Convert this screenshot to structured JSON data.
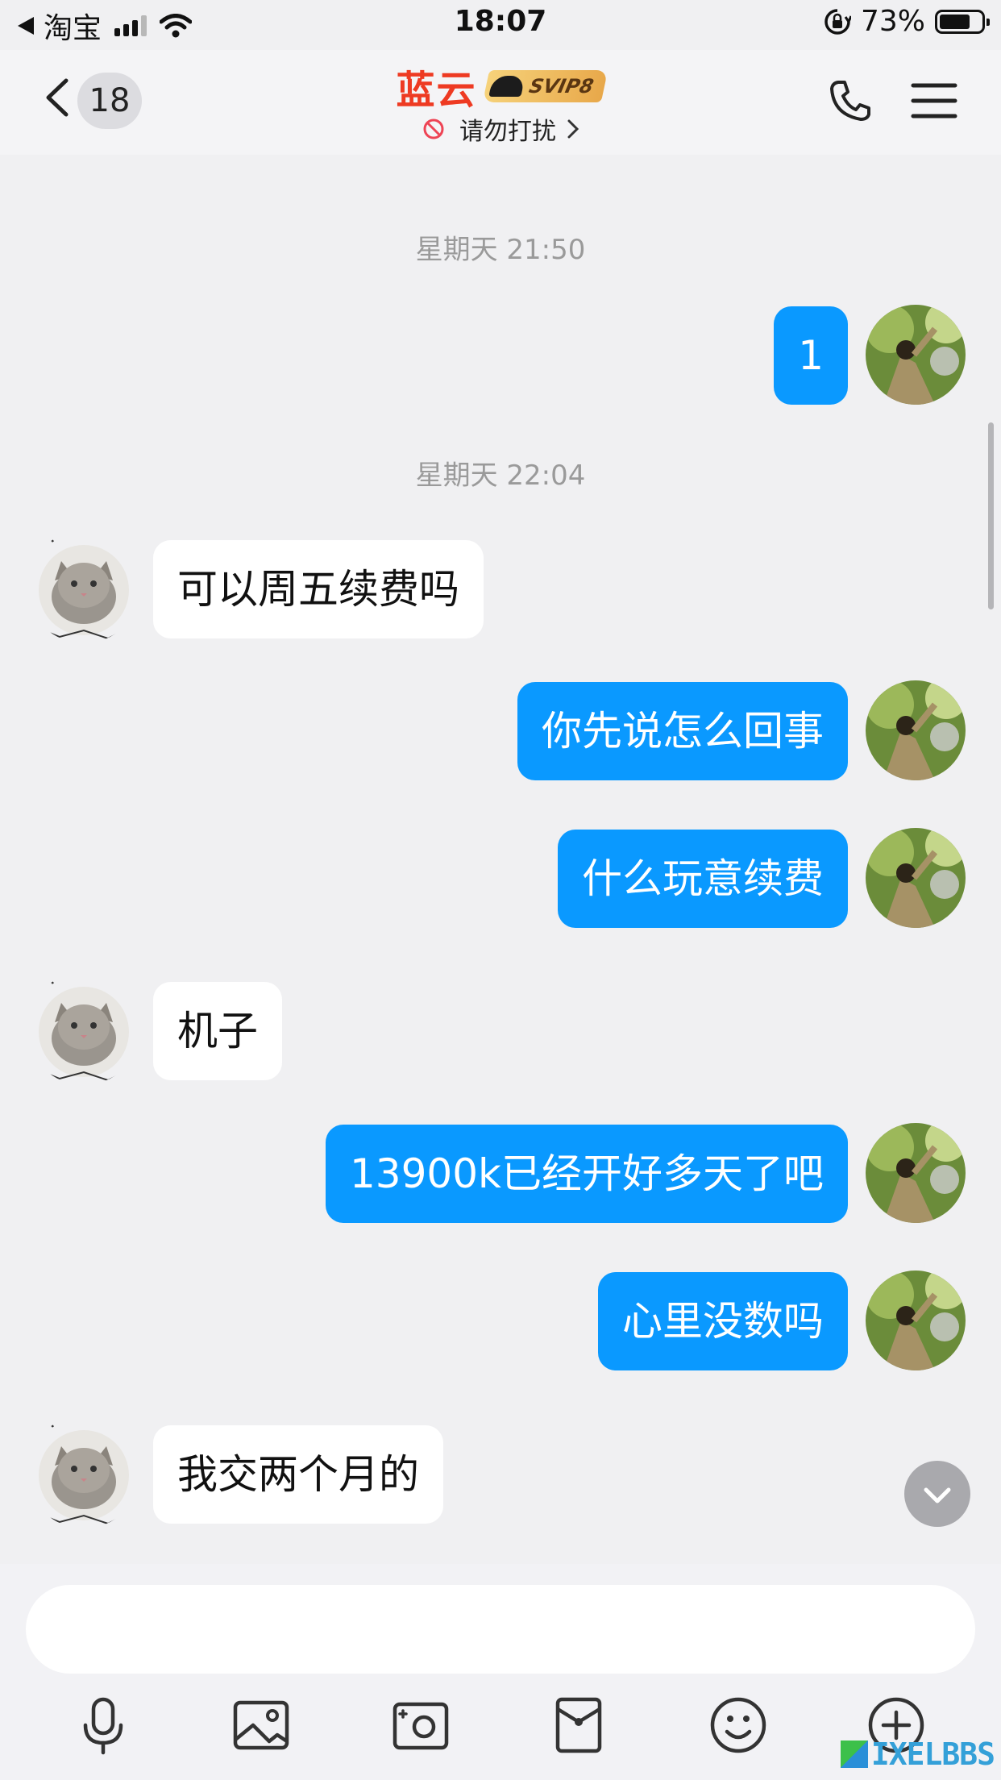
{
  "status_bar": {
    "back_app": "淘宝",
    "time": "18:07",
    "battery": "73%",
    "battery_level": 0.73
  },
  "header": {
    "unread_count": "18",
    "contact_name": "蓝云",
    "vip_badge": "SVIP8",
    "dnd_label": "请勿打扰",
    "title_color": "#ee3a22"
  },
  "chat": {
    "timestamps": [
      "星期天 21:50",
      "星期天 22:04"
    ],
    "messages": [
      {
        "side": "out",
        "text": "1"
      },
      {
        "side": "in",
        "text": "可以周五续费吗"
      },
      {
        "side": "out",
        "text": "你先说怎么回事"
      },
      {
        "side": "out",
        "text": "什么玩意续费"
      },
      {
        "side": "in",
        "text": "机子"
      },
      {
        "side": "out",
        "text": "13900k已经开好多天了吧"
      },
      {
        "side": "out",
        "text": "心里没数吗"
      },
      {
        "side": "in",
        "text": "我交两个月的"
      }
    ],
    "outgoing_bubble_color": "#0a99ff",
    "incoming_bubble_color": "#ffffff"
  },
  "input": {
    "placeholder": ""
  },
  "toolbar": {
    "icons": [
      "microphone-icon",
      "photo-icon",
      "camera-icon",
      "red-packet-icon",
      "emoji-icon",
      "plus-icon"
    ]
  },
  "watermark": {
    "text": "IXELBBS"
  }
}
